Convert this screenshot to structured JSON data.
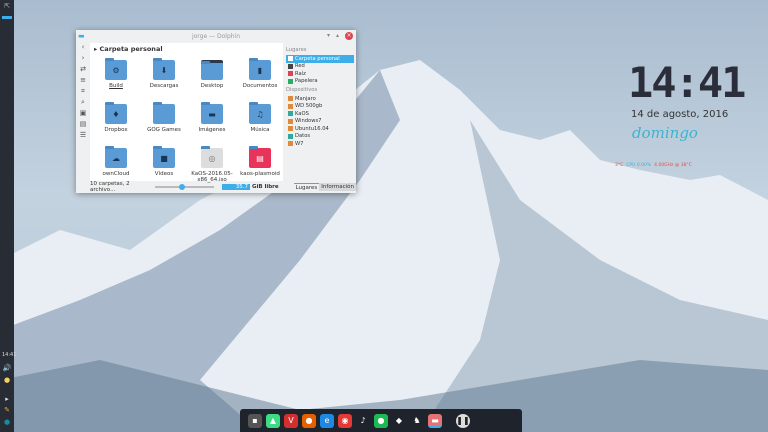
{
  "window": {
    "title": "jorge — Dolphin",
    "breadcrumb": "Carpeta personal",
    "items": [
      {
        "label": "Build",
        "glyph": "⚙"
      },
      {
        "label": "Descargas",
        "glyph": "⬇"
      },
      {
        "label": "Desktop",
        "glyph": ""
      },
      {
        "label": "Documentos",
        "glyph": "▮"
      },
      {
        "label": "Dropbox",
        "glyph": "♦"
      },
      {
        "label": "GOG Games",
        "glyph": ""
      },
      {
        "label": "Imágenes",
        "glyph": "▬"
      },
      {
        "label": "Música",
        "glyph": "♫"
      },
      {
        "label": "ownCloud",
        "glyph": "☁"
      },
      {
        "label": "Vídeos",
        "glyph": "■"
      },
      {
        "label": "KaOS-2016.05-x86_64.iso",
        "glyph": "◎"
      },
      {
        "label": "kaos-plasmoid",
        "glyph": "▤"
      }
    ],
    "places_header": "Lugares",
    "places": [
      "Carpeta personal",
      "Red",
      "Raíz",
      "Papelera"
    ],
    "devices_header": "Dispositivos",
    "devices": [
      "Manjaro",
      "WD 500gb",
      "KaOS",
      "Windows7",
      "Ubuntu16.04",
      "Datos",
      "W7"
    ],
    "status_text": "10 carpetas, 2 archivo...",
    "free_space": "GiB libre",
    "free_value": "35.7",
    "zoom_level": 0.45,
    "tabs": [
      "Lugares",
      "Información"
    ]
  },
  "widgets": {
    "clock": "14:41",
    "date": "14 de agosto, 2016",
    "weekday": "domingo",
    "stats": [
      "3°C",
      "CPU 0.00%",
      "4.00GHz @ 38°C"
    ]
  },
  "panel": {
    "clock": "14:41"
  },
  "taskbar": {
    "apps": [
      "desktop",
      "android",
      "vivaldi",
      "firefox",
      "edge",
      "record",
      "music",
      "spotify",
      "inkscape",
      "gimp",
      "files",
      "pause"
    ]
  },
  "colors": {
    "accent": "#3daee9",
    "folder": "#5b9bd5",
    "close": "#da4453"
  }
}
